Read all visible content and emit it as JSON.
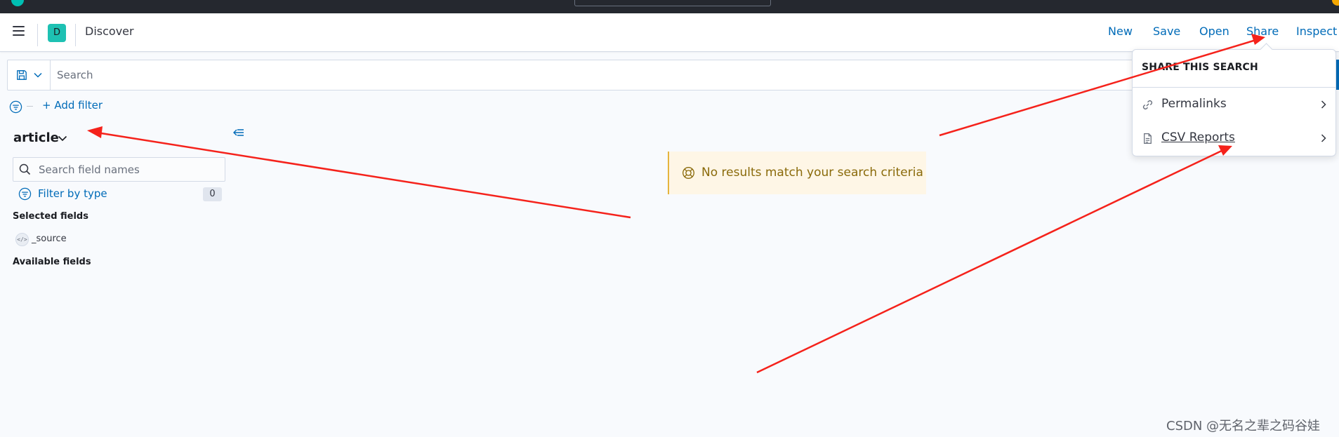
{
  "header": {
    "app_title": "Discover",
    "space_initial": "D",
    "nav": [
      "New",
      "Save",
      "Open",
      "Share",
      "Inspect"
    ]
  },
  "query": {
    "placeholder": "Search"
  },
  "filters": {
    "add_filter_label": "+ Add filter"
  },
  "sidebar": {
    "index_pattern": "article",
    "field_search_placeholder": "Search field names",
    "filter_by_type_label": "Filter by type",
    "filter_count": "0",
    "selected_fields_title": "Selected fields",
    "selected_fields": [
      {
        "name": "_source",
        "type_token": "</>"
      }
    ],
    "available_fields_title": "Available fields"
  },
  "results": {
    "empty_message": "No results match your search criteria"
  },
  "share_menu": {
    "title": "SHARE THIS SEARCH",
    "items": [
      {
        "label": "Permalinks",
        "icon": "link-icon"
      },
      {
        "label": "CSV Reports",
        "icon": "document-icon"
      }
    ]
  },
  "watermark": "CSDN @无名之辈之码谷娃",
  "colors": {
    "link": "#006bb8",
    "annotation_arrow": "#f5221b",
    "top_bar": "#25282f",
    "space_avatar": "#1ec1b3",
    "callout_bg": "#fef6e6",
    "callout_text": "#8a6a0a"
  }
}
